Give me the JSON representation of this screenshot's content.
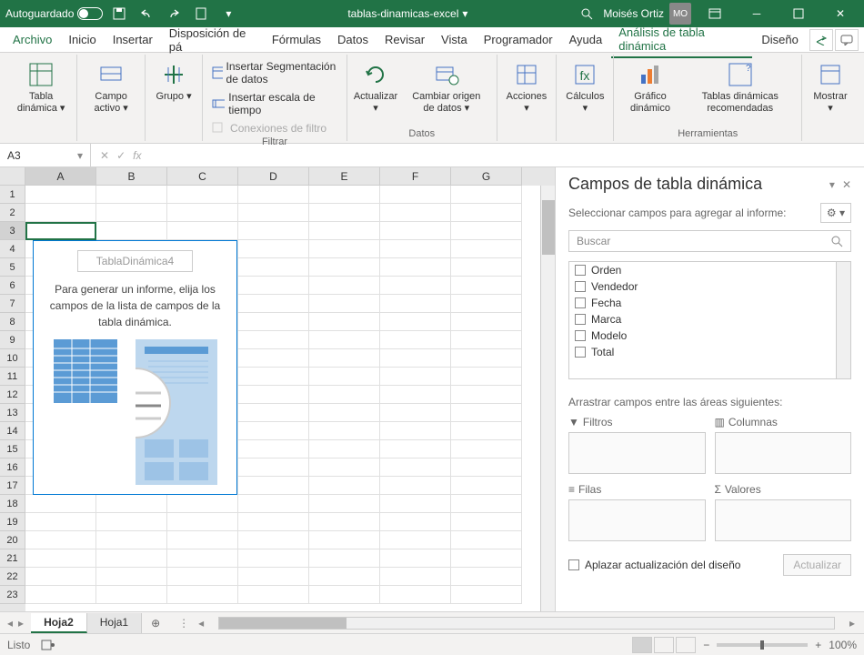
{
  "titlebar": {
    "autosave": "Autoguardado",
    "filename": "tablas-dinamicas-excel",
    "user": "Moisés Ortiz",
    "initials": "MO"
  },
  "tabs": {
    "file": "Archivo",
    "home": "Inicio",
    "insert": "Insertar",
    "layout": "Disposición de pá",
    "formulas": "Fórmulas",
    "data": "Datos",
    "review": "Revisar",
    "view": "Vista",
    "developer": "Programador",
    "help": "Ayuda",
    "analyze": "Análisis de tabla dinámica",
    "design": "Diseño"
  },
  "ribbon": {
    "pivot_table": "Tabla dinámica",
    "active_field": "Campo activo",
    "group": "Grupo",
    "insert_slicer": "Insertar Segmentación de datos",
    "insert_timeline": "Insertar escala de tiempo",
    "filter_connections": "Conexiones de filtro",
    "filter_label": "Filtrar",
    "refresh": "Actualizar",
    "change_source": "Cambiar origen de datos",
    "data_label": "Datos",
    "actions": "Acciones",
    "calculations": "Cálculos",
    "pivot_chart": "Gráfico dinámico",
    "recommended": "Tablas dinámicas recomendadas",
    "tools_label": "Herramientas",
    "show": "Mostrar"
  },
  "formula_bar": {
    "name_box": "A3",
    "fx": "fx"
  },
  "columns": [
    "A",
    "B",
    "C",
    "D",
    "E",
    "F",
    "G"
  ],
  "rows": [
    1,
    2,
    3,
    4,
    5,
    6,
    7,
    8,
    9,
    10,
    11,
    12,
    13,
    14,
    15,
    16,
    17,
    18,
    19,
    20,
    21,
    22,
    23
  ],
  "pivot_placeholder": {
    "title": "TablaDinámica4",
    "text": "Para generar un informe, elija los campos de la lista de campos de la tabla dinámica."
  },
  "pane": {
    "title": "Campos de tabla dinámica",
    "subtitle": "Seleccionar campos para agregar al informe:",
    "search": "Buscar",
    "fields": [
      "Orden",
      "Vendedor",
      "Fecha",
      "Marca",
      "Modelo",
      "Total"
    ],
    "areas_label": "Arrastrar campos entre las áreas siguientes:",
    "filters": "Filtros",
    "columns": "Columnas",
    "rows": "Filas",
    "values": "Valores",
    "defer": "Aplazar actualización del diseño",
    "update": "Actualizar"
  },
  "sheets": {
    "active": "Hoja2",
    "other": "Hoja1"
  },
  "status": {
    "ready": "Listo",
    "zoom": "100%"
  }
}
